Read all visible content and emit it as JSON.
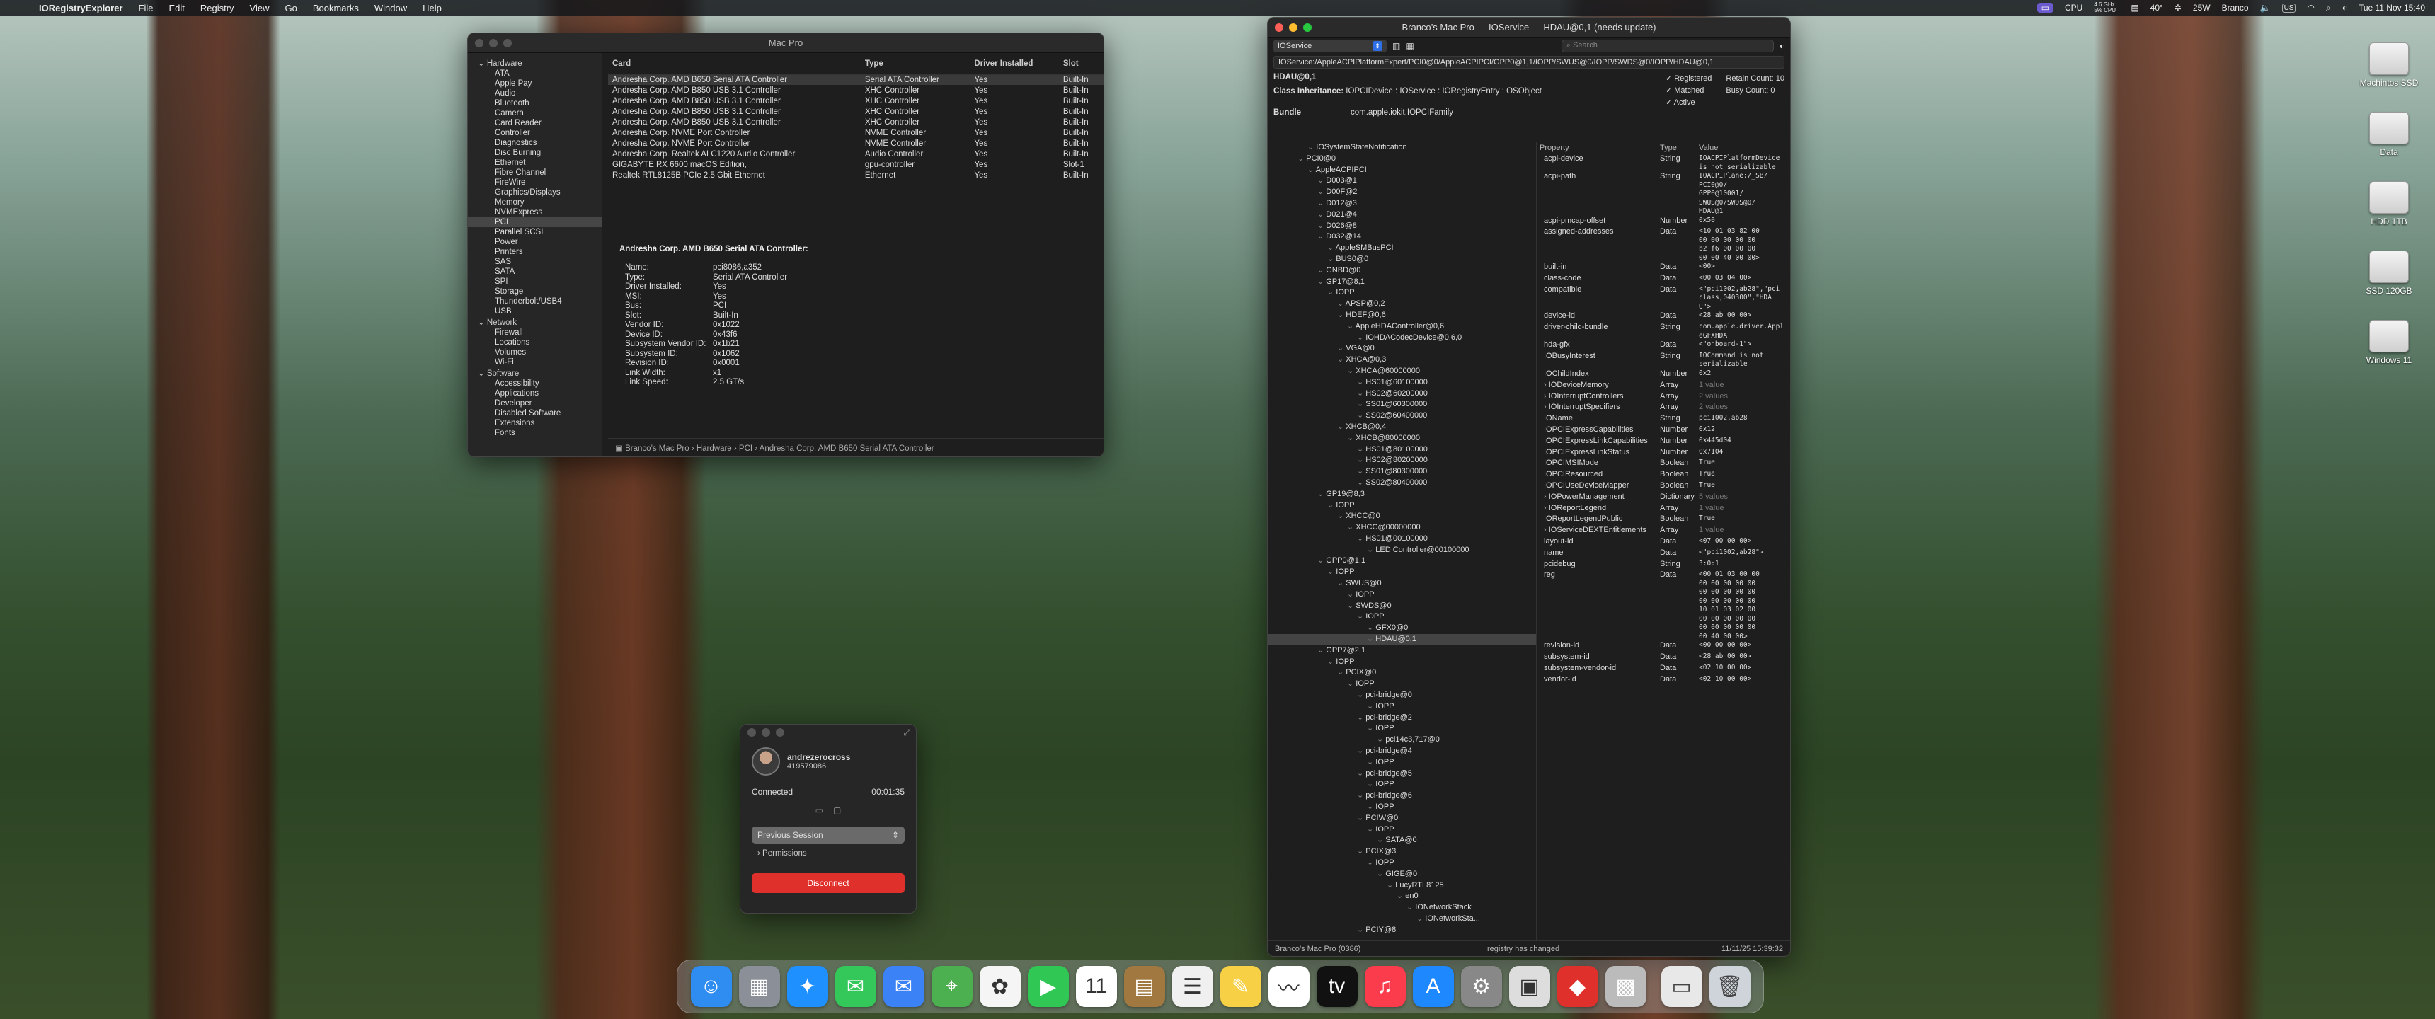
{
  "menubar": {
    "app": "IORegistryExplorer",
    "items": [
      "File",
      "Edit",
      "Registry",
      "View",
      "Go",
      "Bookmarks",
      "Window",
      "Help"
    ],
    "status": {
      "cpu": "CPU",
      "cpu_freq": "4.6 GHz\n5% CPU",
      "temp": "40°",
      "power": "25W",
      "user": "Branco",
      "kbd": "US",
      "datetime": "Tue 11 Nov 15:40"
    }
  },
  "desktop": {
    "drives": [
      "Machintos SSD",
      "Data",
      "HDD 1TB",
      "SSD 120GB",
      "Windows 11"
    ]
  },
  "sysinfo": {
    "title": "Mac Pro",
    "sidebar": [
      {
        "t": "grp",
        "label": "Hardware"
      },
      {
        "t": "it",
        "label": "ATA"
      },
      {
        "t": "it",
        "label": "Apple Pay"
      },
      {
        "t": "it",
        "label": "Audio"
      },
      {
        "t": "it",
        "label": "Bluetooth"
      },
      {
        "t": "it",
        "label": "Camera"
      },
      {
        "t": "it",
        "label": "Card Reader"
      },
      {
        "t": "it",
        "label": "Controller"
      },
      {
        "t": "it",
        "label": "Diagnostics"
      },
      {
        "t": "it",
        "label": "Disc Burning"
      },
      {
        "t": "it",
        "label": "Ethernet"
      },
      {
        "t": "it",
        "label": "Fibre Channel"
      },
      {
        "t": "it",
        "label": "FireWire"
      },
      {
        "t": "it",
        "label": "Graphics/Displays"
      },
      {
        "t": "it",
        "label": "Memory"
      },
      {
        "t": "it",
        "label": "NVMExpress"
      },
      {
        "t": "it",
        "label": "PCI",
        "sel": true
      },
      {
        "t": "it",
        "label": "Parallel SCSI"
      },
      {
        "t": "it",
        "label": "Power"
      },
      {
        "t": "it",
        "label": "Printers"
      },
      {
        "t": "it",
        "label": "SAS"
      },
      {
        "t": "it",
        "label": "SATA"
      },
      {
        "t": "it",
        "label": "SPI"
      },
      {
        "t": "it",
        "label": "Storage"
      },
      {
        "t": "it",
        "label": "Thunderbolt/USB4"
      },
      {
        "t": "it",
        "label": "USB"
      },
      {
        "t": "grp",
        "label": "Network"
      },
      {
        "t": "it",
        "label": "Firewall"
      },
      {
        "t": "it",
        "label": "Locations"
      },
      {
        "t": "it",
        "label": "Volumes"
      },
      {
        "t": "it",
        "label": "Wi-Fi"
      },
      {
        "t": "grp",
        "label": "Software"
      },
      {
        "t": "it",
        "label": "Accessibility"
      },
      {
        "t": "it",
        "label": "Applications"
      },
      {
        "t": "it",
        "label": "Developer"
      },
      {
        "t": "it",
        "label": "Disabled Software"
      },
      {
        "t": "it",
        "label": "Extensions"
      },
      {
        "t": "it",
        "label": "Fonts"
      }
    ],
    "columns": [
      "Card",
      "Type",
      "Driver Installed",
      "Slot"
    ],
    "rows": [
      [
        "Andresha Corp. AMD B650 Serial ATA Controller",
        "Serial ATA Controller",
        "Yes",
        "Built-In"
      ],
      [
        "Andresha Corp. AMD B850 USB 3.1 Controller",
        "XHC Controller",
        "Yes",
        "Built-In"
      ],
      [
        "Andresha Corp. AMD B850 USB 3.1 Controller",
        "XHC Controller",
        "Yes",
        "Built-In"
      ],
      [
        "Andresha Corp. AMD B850 USB 3.1 Controller",
        "XHC Controller",
        "Yes",
        "Built-In"
      ],
      [
        "Andresha Corp. AMD B850 USB 3.1 Controller",
        "XHC Controller",
        "Yes",
        "Built-In"
      ],
      [
        "Andresha Corp. NVME Port Controller",
        "NVME Controller",
        "Yes",
        "Built-In"
      ],
      [
        "Andresha Corp. NVME Port Controller",
        "NVME Controller",
        "Yes",
        "Built-In"
      ],
      [
        "Andresha Corp. Realtek ALC1220 Audio Controller",
        "Audio Controller",
        "Yes",
        "Built-In"
      ],
      [
        "GIGABYTE RX 6600 macOS Edition,",
        "gpu-controller",
        "Yes",
        "Slot-1"
      ],
      [
        "Realtek RTL8125B PCIe 2.5 Gbit Ethernet",
        "Ethernet",
        "Yes",
        "Built-In"
      ]
    ],
    "detail_title": "Andresha Corp. AMD B650 Serial ATA Controller:",
    "detail": [
      [
        "Name:",
        "pci8086,a352"
      ],
      [
        "Type:",
        "Serial ATA Controller"
      ],
      [
        "Driver Installed:",
        "Yes"
      ],
      [
        "MSI:",
        "Yes"
      ],
      [
        "Bus:",
        "PCI"
      ],
      [
        "Slot:",
        "Built-In"
      ],
      [
        "Vendor ID:",
        "0x1022"
      ],
      [
        "Device ID:",
        "0x43f6"
      ],
      [
        "Subsystem Vendor ID:",
        "0x1b21"
      ],
      [
        "Subsystem ID:",
        "0x1062"
      ],
      [
        "Revision ID:",
        "0x0001"
      ],
      [
        "Link Width:",
        "x1"
      ],
      [
        "Link Speed:",
        "2.5 GT/s"
      ]
    ],
    "breadcrumb": "Branco’s Mac Pro › Hardware › PCI › Andresha Corp. AMD B650 Serial ATA Controller"
  },
  "ioreg": {
    "title": "Branco’s Mac Pro — IOService — HDAU@0,1 (needs update)",
    "plane": "IOService",
    "search_placeholder": "Search",
    "path": "IOService:/AppleACPIPlatformExpert/PCI0@0/AppleACPIPCI/GPP0@1,1/IOPP/SWUS@0/IOPP/SWDS@0/IOPP/HDAU@0,1",
    "object": "HDAU@0,1",
    "class_label": "Class Inheritance:",
    "class_value": "IOPCIDevice : IOService : IORegistryEntry : OSObject",
    "bundle_label": "Bundle",
    "bundle_value": "com.apple.iokit.IOPCIFamily",
    "checks": [
      [
        "Registered",
        "Retain Count:",
        "10"
      ],
      [
        "Matched",
        "Busy Count:",
        "0"
      ],
      [
        "Active",
        "",
        ""
      ]
    ],
    "tree": [
      [
        3,
        "IOSystemStateNotification"
      ],
      [
        2,
        "PCI0@0"
      ],
      [
        3,
        "AppleACPIPCI"
      ],
      [
        4,
        "D003@1"
      ],
      [
        4,
        "D00F@2"
      ],
      [
        4,
        "D012@3"
      ],
      [
        4,
        "D021@4"
      ],
      [
        4,
        "D026@8"
      ],
      [
        4,
        "D032@14"
      ],
      [
        5,
        "AppleSMBusPCI"
      ],
      [
        5,
        "BUS0@0"
      ],
      [
        4,
        "GNBD@0"
      ],
      [
        4,
        "GP17@8,1"
      ],
      [
        5,
        "IOPP"
      ],
      [
        6,
        "APSP@0,2"
      ],
      [
        6,
        "HDEF@0,6"
      ],
      [
        7,
        "AppleHDAController@0,6"
      ],
      [
        8,
        "IOHDACodecDevice@0,6,0"
      ],
      [
        6,
        "VGA@0"
      ],
      [
        6,
        "XHCA@0,3"
      ],
      [
        7,
        "XHCA@60000000"
      ],
      [
        8,
        "HS01@60100000"
      ],
      [
        8,
        "HS02@60200000"
      ],
      [
        8,
        "SS01@60300000"
      ],
      [
        8,
        "SS02@60400000"
      ],
      [
        6,
        "XHCB@0,4"
      ],
      [
        7,
        "XHCB@80000000"
      ],
      [
        8,
        "HS01@80100000"
      ],
      [
        8,
        "HS02@80200000"
      ],
      [
        8,
        "SS01@80300000"
      ],
      [
        8,
        "SS02@80400000"
      ],
      [
        4,
        "GP19@8,3"
      ],
      [
        5,
        "IOPP"
      ],
      [
        6,
        "XHCC@0"
      ],
      [
        7,
        "XHCC@00000000"
      ],
      [
        8,
        "HS01@00100000"
      ],
      [
        9,
        "LED Controller@00100000"
      ],
      [
        4,
        "GPP0@1,1"
      ],
      [
        5,
        "IOPP"
      ],
      [
        6,
        "SWUS@0"
      ],
      [
        7,
        "IOPP"
      ],
      [
        7,
        "SWDS@0"
      ],
      [
        8,
        "IOPP"
      ],
      [
        9,
        "GFX0@0"
      ],
      [
        9,
        "HDAU@0,1"
      ],
      [
        4,
        "GPP7@2,1"
      ],
      [
        5,
        "IOPP"
      ],
      [
        6,
        "PCIX@0"
      ],
      [
        7,
        "IOPP"
      ],
      [
        8,
        "pci-bridge@0"
      ],
      [
        9,
        "IOPP"
      ],
      [
        8,
        "pci-bridge@2"
      ],
      [
        9,
        "IOPP"
      ],
      [
        10,
        "pci14c3,717@0"
      ],
      [
        8,
        "pci-bridge@4"
      ],
      [
        9,
        "IOPP"
      ],
      [
        8,
        "pci-bridge@5"
      ],
      [
        9,
        "IOPP"
      ],
      [
        8,
        "pci-bridge@6"
      ],
      [
        9,
        "IOPP"
      ],
      [
        8,
        "PCIW@0"
      ],
      [
        9,
        "IOPP"
      ],
      [
        10,
        "SATA@0"
      ],
      [
        8,
        "PCIX@3"
      ],
      [
        9,
        "IOPP"
      ],
      [
        10,
        "GIGE@0"
      ],
      [
        11,
        "LucyRTL8125"
      ],
      [
        12,
        "en0"
      ],
      [
        13,
        "IONetworkStack"
      ],
      [
        14,
        "IONetworkSta..."
      ],
      [
        8,
        "PCIY@8"
      ]
    ],
    "tree_selected": "HDAU@0,1",
    "prop_headers": [
      "Property",
      "Type",
      "Value"
    ],
    "props": [
      [
        "acpi-device",
        "String",
        "IOACPIPlatformDevice\nis not serializable",
        false
      ],
      [
        "acpi-path",
        "String",
        "IOACPIPlane:/_SB/\nPCI0@0/\nGPP0@10001/\nSWUS@0/SWDS@0/\nHDAU@1",
        false
      ],
      [
        "acpi-pmcap-offset",
        "Number",
        "0x50",
        false
      ],
      [
        "assigned-addresses",
        "Data",
        "<10 01 03 82 00\n00 00 00 00 00\nb2 f6 00 00 00\n00 00 40 00 00>",
        false
      ],
      [
        "built-in",
        "Data",
        "<00>",
        false
      ],
      [
        "class-code",
        "Data",
        "<00 03 04 00>",
        false
      ],
      [
        "compatible",
        "Data",
        "<\"pci1002,ab28\",\"pci\nclass,040300\",\"HDA\nU\">",
        false
      ],
      [
        "device-id",
        "Data",
        "<28 ab 00 00>",
        false
      ],
      [
        "driver-child-bundle",
        "String",
        "com.apple.driver.Appl\neGFXHDA",
        false
      ],
      [
        "hda-gfx",
        "Data",
        "<\"onboard-1\">",
        false
      ],
      [
        "IOBusyInterest",
        "String",
        "IOCommand is not\nserializable",
        false
      ],
      [
        "IOChildIndex",
        "Number",
        "0x2",
        false
      ],
      [
        "IODeviceMemory",
        "Array",
        "1 value",
        true
      ],
      [
        "IOInterruptControllers",
        "Array",
        "2 values",
        true
      ],
      [
        "IOInterruptSpecifiers",
        "Array",
        "2 values",
        true
      ],
      [
        "IOName",
        "String",
        "pci1002,ab28",
        false
      ],
      [
        "IOPCIExpressCapabilities",
        "Number",
        "0x12",
        false
      ],
      [
        "IOPCIExpressLinkCapabilities",
        "Number",
        "0x445d04",
        false
      ],
      [
        "IOPCIExpressLinkStatus",
        "Number",
        "0x7104",
        false
      ],
      [
        "IOPCIMSIMode",
        "Boolean",
        "True",
        false
      ],
      [
        "IOPCIResourced",
        "Boolean",
        "True",
        false
      ],
      [
        "IOPCIUseDeviceMapper",
        "Boolean",
        "True",
        false
      ],
      [
        "IOPowerManagement",
        "Dictionary",
        "5 values",
        true
      ],
      [
        "IOReportLegend",
        "Array",
        "1 value",
        true
      ],
      [
        "IOReportLegendPublic",
        "Boolean",
        "True",
        false
      ],
      [
        "IOServiceDEXTEntitlements",
        "Array",
        "1 value",
        true
      ],
      [
        "layout-id",
        "Data",
        "<07 00 00 00>",
        false
      ],
      [
        "name",
        "Data",
        "<\"pci1002,ab28\">",
        false
      ],
      [
        "pcidebug",
        "String",
        "3:0:1",
        false
      ],
      [
        "reg",
        "Data",
        "<00 01 03 00 00\n00 00 00 00 00\n00 00 00 00 00\n00 00 00 00 00\n10 01 03 02 00\n00 00 00 00 00\n00 00 00 00 00\n00 40 00 00>",
        false
      ],
      [
        "revision-id",
        "Data",
        "<00 00 00 00>",
        false
      ],
      [
        "subsystem-id",
        "Data",
        "<28 ab 00 00>",
        false
      ],
      [
        "subsystem-vendor-id",
        "Data",
        "<02 10 00 00>",
        false
      ],
      [
        "vendor-id",
        "Data",
        "<02 10 00 00>",
        false
      ]
    ],
    "status_left": "Branco’s Mac Pro (0386)",
    "status_mid": "registry has changed",
    "status_right": "11/11/25 15:39:32"
  },
  "remote": {
    "name": "andrezerocross",
    "id": "419579086",
    "status": "Connected",
    "timer": "00:01:35",
    "session": "Previous Session",
    "permissions": "Permissions",
    "disconnect": "Disconnect",
    "accent": "#e0302b"
  },
  "dock": {
    "apps": [
      {
        "name": "finder",
        "glyph": "☺",
        "bg": "#2f8cf0"
      },
      {
        "name": "launchpad",
        "glyph": "▦",
        "bg": "#8a8f98"
      },
      {
        "name": "safari",
        "glyph": "✦",
        "bg": "#1e90ff"
      },
      {
        "name": "messages",
        "glyph": "✉",
        "bg": "#34c759"
      },
      {
        "name": "mail",
        "glyph": "✉",
        "bg": "#3b82f6"
      },
      {
        "name": "maps",
        "glyph": "⌖",
        "bg": "#4caf50"
      },
      {
        "name": "photos",
        "glyph": "✿",
        "bg": "#f5f5f5"
      },
      {
        "name": "facetime",
        "glyph": "▶",
        "bg": "#30c754"
      },
      {
        "name": "calendar",
        "glyph": "11",
        "bg": "#ffffff"
      },
      {
        "name": "notes-brown",
        "glyph": "▤",
        "bg": "#a07840"
      },
      {
        "name": "reminders",
        "glyph": "☰",
        "bg": "#f0f0f0"
      },
      {
        "name": "notes",
        "glyph": "✎",
        "bg": "#f7d046"
      },
      {
        "name": "freeform",
        "glyph": "〰",
        "bg": "#ffffff"
      },
      {
        "name": "apple-tv",
        "glyph": "tv",
        "bg": "#111111"
      },
      {
        "name": "music",
        "glyph": "♫",
        "bg": "#fa3c4c"
      },
      {
        "name": "app-store",
        "glyph": "A",
        "bg": "#1e88ff"
      },
      {
        "name": "system-settings",
        "glyph": "⚙",
        "bg": "#888888"
      },
      {
        "name": "system-info",
        "glyph": "▣",
        "bg": "#dddddd"
      },
      {
        "name": "anydesk",
        "glyph": "◆",
        "bg": "#e0302b"
      },
      {
        "name": "ioregistry",
        "glyph": "▩",
        "bg": "#bbbbbb"
      }
    ],
    "right": [
      {
        "name": "documents",
        "glyph": "▭",
        "bg": "#e8e8e8"
      },
      {
        "name": "trash",
        "glyph": "🗑",
        "bg": "#cfd4da"
      }
    ]
  }
}
